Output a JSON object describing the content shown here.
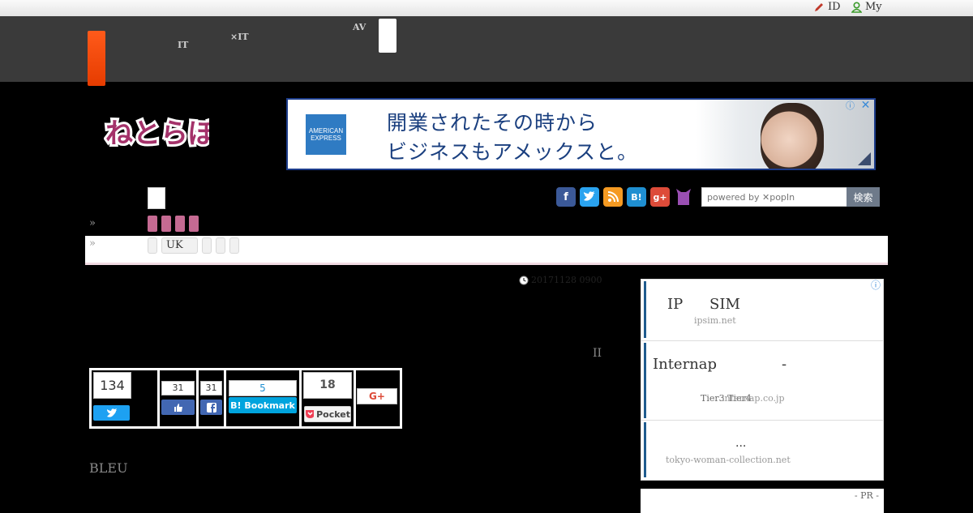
{
  "topbar": {
    "id_link": "ID",
    "my_link": "My"
  },
  "nav": {
    "item1_line1": "ᅟᅟ",
    "item1_line2": "IT",
    "item2_line1": "ᅟᅟᅟ",
    "item2_line2": "×IT",
    "item3_line1": "AV",
    "item3_line2": "ᅟᅟ"
  },
  "logo": {
    "text": "ねとらぼ"
  },
  "ad": {
    "brand_line1": "AMERICAN",
    "brand_line2": "EXPRESS",
    "headline_line1": "開業されたその時から",
    "headline_line2": "ビジネスもアメックスと。",
    "info_icon": "ⓘ",
    "close_icon": "✕"
  },
  "breadcrumbs": {
    "raquo": "»",
    "uk_tab": "UK"
  },
  "social_icons": [
    "facebook-icon",
    "twitter-icon",
    "rss-icon",
    "hatena-bookmark-icon",
    "google-plus-icon",
    "cat-icon"
  ],
  "search": {
    "placeholder": "powered by ✕popIn",
    "button": "検索"
  },
  "article": {
    "date": "20171128 0900",
    "side_mark": "II",
    "subheading": "BLEU"
  },
  "share": {
    "twitter_count": "134",
    "like_count": "31",
    "fb_share_count": "31",
    "hatena_count": "5",
    "hatena_label": "B! Bookmark",
    "pocket_count": "18",
    "pocket_label": "Pocket",
    "gplus_label": "G+"
  },
  "sidebar": {
    "info_icon": "ⓘ",
    "items": [
      {
        "title_a": "IP",
        "title_b": "SIM",
        "url": "ipsim.net"
      },
      {
        "title_a": "Internap",
        "title_b": "-",
        "sub1": "Tier3 Tier4",
        "url": "internap.co.jp"
      },
      {
        "title_a": "...",
        "url": "tokyo-woman-collection.net"
      }
    ]
  },
  "pr": {
    "label": "- PR -"
  },
  "colors": {
    "nav_bg": "#3a3a3a",
    "accent_orange": "#ff5a1a",
    "pink": "#c56a92",
    "twitter": "#1da1f2",
    "facebook": "#4267b2",
    "hatena": "#00a4de",
    "pocket": "#ef4056"
  }
}
